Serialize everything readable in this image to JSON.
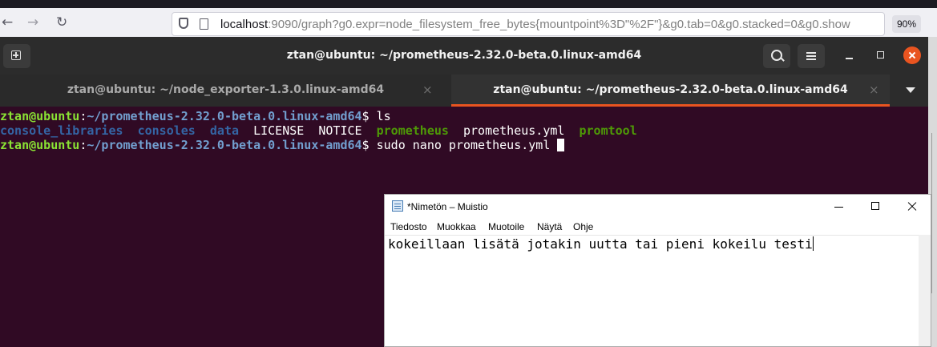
{
  "browser": {
    "url_host": "localhost",
    "url_rest": ":9090/graph?g0.expr=node_filesystem_free_bytes{mountpoint%3D\"%2F\"}&g0.tab=0&g0.stacked=0&g0.show",
    "zoom": "90%",
    "back_icon": "←",
    "forward_icon": "→",
    "reload_icon": "↻"
  },
  "terminal": {
    "window_title": "ztan@ubuntu: ~/prometheus-2.32.0-beta.0.linux-amd64",
    "tabs": [
      {
        "label": "ztan@ubuntu: ~/node_exporter-1.3.0.linux-amd64",
        "close": "×"
      },
      {
        "label": "ztan@ubuntu: ~/prometheus-2.32.0-beta.0.linux-amd64",
        "close": "×"
      }
    ],
    "lines": [
      {
        "user": "ztan@ubuntu",
        "colon": ":",
        "path": "~/prometheus-2.32.0-beta.0.linux-amd64",
        "prompt": "$ ",
        "cmd": "ls"
      },
      {
        "entries": [
          {
            "name": "console_libraries",
            "kind": "dir"
          },
          {
            "name": "consoles",
            "kind": "dir"
          },
          {
            "name": "data",
            "kind": "dir"
          },
          {
            "name": "LICENSE",
            "kind": "file"
          },
          {
            "name": "NOTICE",
            "kind": "file"
          },
          {
            "name": "prometheus",
            "kind": "exe"
          },
          {
            "name": "prometheus.yml",
            "kind": "file"
          },
          {
            "name": "promtool",
            "kind": "exe"
          }
        ]
      },
      {
        "user": "ztan@ubuntu",
        "colon": ":",
        "path": "~/prometheus-2.32.0-beta.0.linux-amd64",
        "prompt": "$ ",
        "cmd": "sudo nano prometheus.yml "
      }
    ],
    "colors": {
      "background": "#300a24",
      "user": "#8ae234",
      "path": "#729fcf",
      "dir": "#3465a4",
      "exe": "#4e9a06",
      "accent": "#e95420"
    }
  },
  "notepad": {
    "title": "*Nimetön – Muistio",
    "menu": [
      "Tiedosto",
      "Muokkaa",
      "Muotoile",
      "Näytä",
      "Ohje"
    ],
    "content": "kokeillaan lisätä jotakin uutta tai pieni kokeilu testi"
  }
}
